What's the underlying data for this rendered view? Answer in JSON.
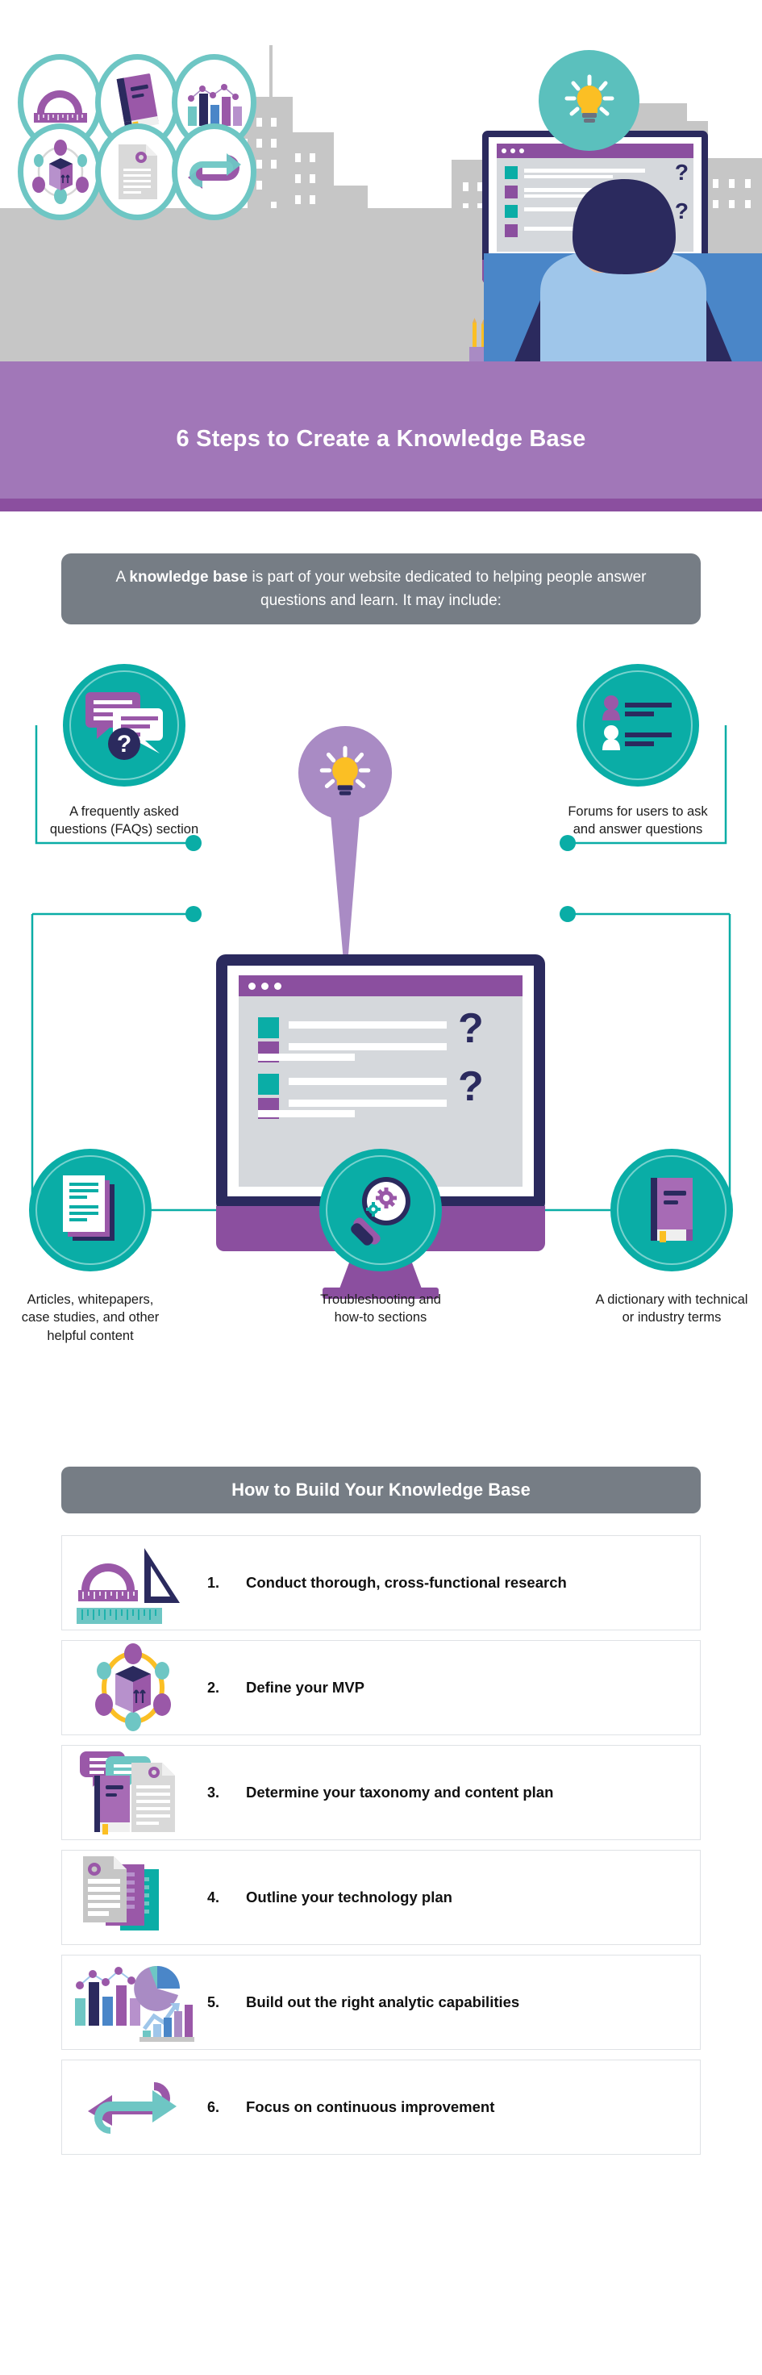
{
  "colors": {
    "teal": "#0aada6",
    "teal_light": "#6ec6c4",
    "purple": "#8b4f9f",
    "purple_light": "#a98bc4",
    "navy": "#2b2a5e",
    "gray_band": "#767d85",
    "title_band": "#a177b8",
    "city_gray": "#c6c6c6",
    "yellow": "#fbbf24"
  },
  "hero": {
    "bubbles": [
      {
        "icon": "protractor-ruler-icon"
      },
      {
        "icon": "book-icon"
      },
      {
        "icon": "bar-chart-icon"
      },
      {
        "icon": "product-cube-network-icon"
      },
      {
        "icon": "document-gear-icon"
      },
      {
        "icon": "continuous-loop-arrows-icon"
      }
    ],
    "lightbulb_icon": "lightbulb-icon",
    "person_icon": "person-at-desk-icon",
    "monitor_icon": "desktop-monitor-icon",
    "pencil_cup_icon": "pencil-cup-icon"
  },
  "title_band": {
    "title": "6 Steps to Create a Knowledge Base"
  },
  "intro": {
    "lead": "A ",
    "bold": "knowledge base",
    "rest": " is part of your website dedicated to helping people answer questions and learn. It may include:"
  },
  "diagram": {
    "center_icon": "lightbulb-pin-icon",
    "monitor_icon": "knowledge-base-monitor-icon",
    "nodes": [
      {
        "id": "faqs",
        "icon": "chat-bubbles-question-icon",
        "label": "A frequently asked\nquestions (FAQs) section"
      },
      {
        "id": "forums",
        "icon": "forum-users-icon",
        "label": "Forums for users to ask\nand answer questions"
      },
      {
        "id": "articles",
        "icon": "documents-stack-icon",
        "label": "Articles, whitepapers,\ncase studies, and other\nhelpful content"
      },
      {
        "id": "troubleshoot",
        "icon": "magnifier-gears-icon",
        "label": "Troubleshooting and\nhow-to sections"
      },
      {
        "id": "dictionary",
        "icon": "book-icon",
        "label": "A dictionary with technical\nor industry terms"
      }
    ]
  },
  "build_section": {
    "heading": "How to Build Your Knowledge Base",
    "steps": [
      {
        "number": "1.",
        "text": "Conduct thorough, cross-functional research",
        "icon": "protractor-ruler-icon"
      },
      {
        "number": "2.",
        "text": "Define your MVP",
        "icon": "product-cube-network-icon"
      },
      {
        "number": "3.",
        "text": "Determine your taxonomy and content plan",
        "icon": "book-chat-document-icon"
      },
      {
        "number": "4.",
        "text": "Outline your technology plan",
        "icon": "documents-gear-icon"
      },
      {
        "number": "5.",
        "text": "Build out the right analytic capabilities",
        "icon": "analytics-charts-icon"
      },
      {
        "number": "6.",
        "text": "Focus on continuous improvement",
        "icon": "continuous-loop-arrows-icon"
      }
    ]
  }
}
